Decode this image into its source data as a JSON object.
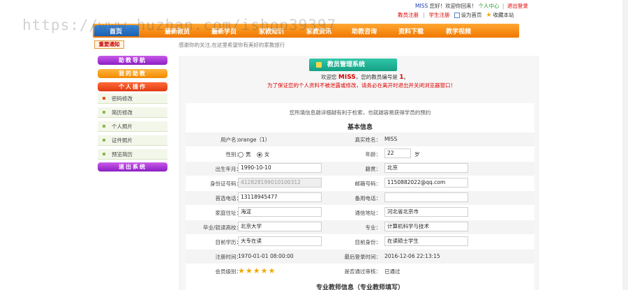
{
  "watermark": "https://www.huzhan.com/ishop39397",
  "toplinks": {
    "user": "MISS",
    "greeting": "您好！欢迎你回来！",
    "center": "个人中心",
    "logout": "退出登录"
  },
  "reglinks": {
    "teacher_reg": "教员注册",
    "student_reg": "学生注册",
    "set_home": "设为首页",
    "favorite": "收藏本站"
  },
  "nav": {
    "items": [
      "首页",
      "最新教员",
      "最新学员",
      "家教知识",
      "家教资讯",
      "助教咨询",
      "资料下载",
      "教学视频"
    ]
  },
  "notice": {
    "tag": "重要通知",
    "text": "感谢你的关注,在这里希望你有美好的家教旅行"
  },
  "sidebar": {
    "nav_title": "助教导航",
    "my_tutor": "我的助教",
    "personal_ops": "个人操作",
    "menu": [
      "密码修改",
      "简历修改",
      "个人照片",
      "证件照片",
      "预览简历"
    ],
    "logout": "退出系统"
  },
  "panel": {
    "title": "教员管理系统",
    "welcome_prefix": "欢迎您",
    "user": "MISS",
    "welcome_mid": "，您的教员编号是",
    "teacher_no": "1",
    "warn": "为了保证您的个人资料不被泄露或修改，请务必在离开时退出并关闭浏览器窗口！",
    "tip": "您所填信息越详细越有利于检索，也就越容易获得学员的预约",
    "basic_title": "基本信息",
    "pro_title": "专业教师信息（专业教师填写）"
  },
  "form": {
    "username_label": "用户名：",
    "username": "orange（1）",
    "realname_label": "真实姓名：",
    "realname": "MISS",
    "gender_label": "性别：",
    "male": "男",
    "female": "女",
    "age_label": "年龄：",
    "age": "22",
    "age_unit": "岁",
    "birth_label": "出生年月：",
    "birth": "1990-10-10",
    "native_label": "籍贯：",
    "native": "北京",
    "idcard_label": "身份证号码：",
    "idcard": "412828199010100312",
    "email_label": "邮箱号码：",
    "email": "1150882022@qq.com",
    "phone_label": "首选电话：",
    "phone": "13118945477",
    "phone2_label": "备用电话：",
    "phone2": "",
    "address_label": "家庭住址：",
    "address": "海淀",
    "mail_label": "通信地址：",
    "mail": "河北省北京市",
    "school_label": "毕业/就读高校：",
    "school": "北京大学",
    "major_label": "专业：",
    "major": "计算机科学与技术",
    "edu_label": "目前学历：",
    "edu": "大专在读",
    "status_label": "目前身份：",
    "status": "在读硕士学生",
    "regtime_label": "注册时间：",
    "regtime": "1970-01-01 08:00:00",
    "lastlogin_label": "最后登录时间：",
    "lastlogin": "2016-12-06 22:13:15",
    "level_label": "会员级别：",
    "level_stars": 5,
    "stars_text": "★★★★★",
    "audit_label": "是否通过审核：",
    "audit": "已通过"
  },
  "colors": {
    "nav": "#f07800",
    "accent_red": "#dd0000",
    "banner": "#15a084"
  }
}
